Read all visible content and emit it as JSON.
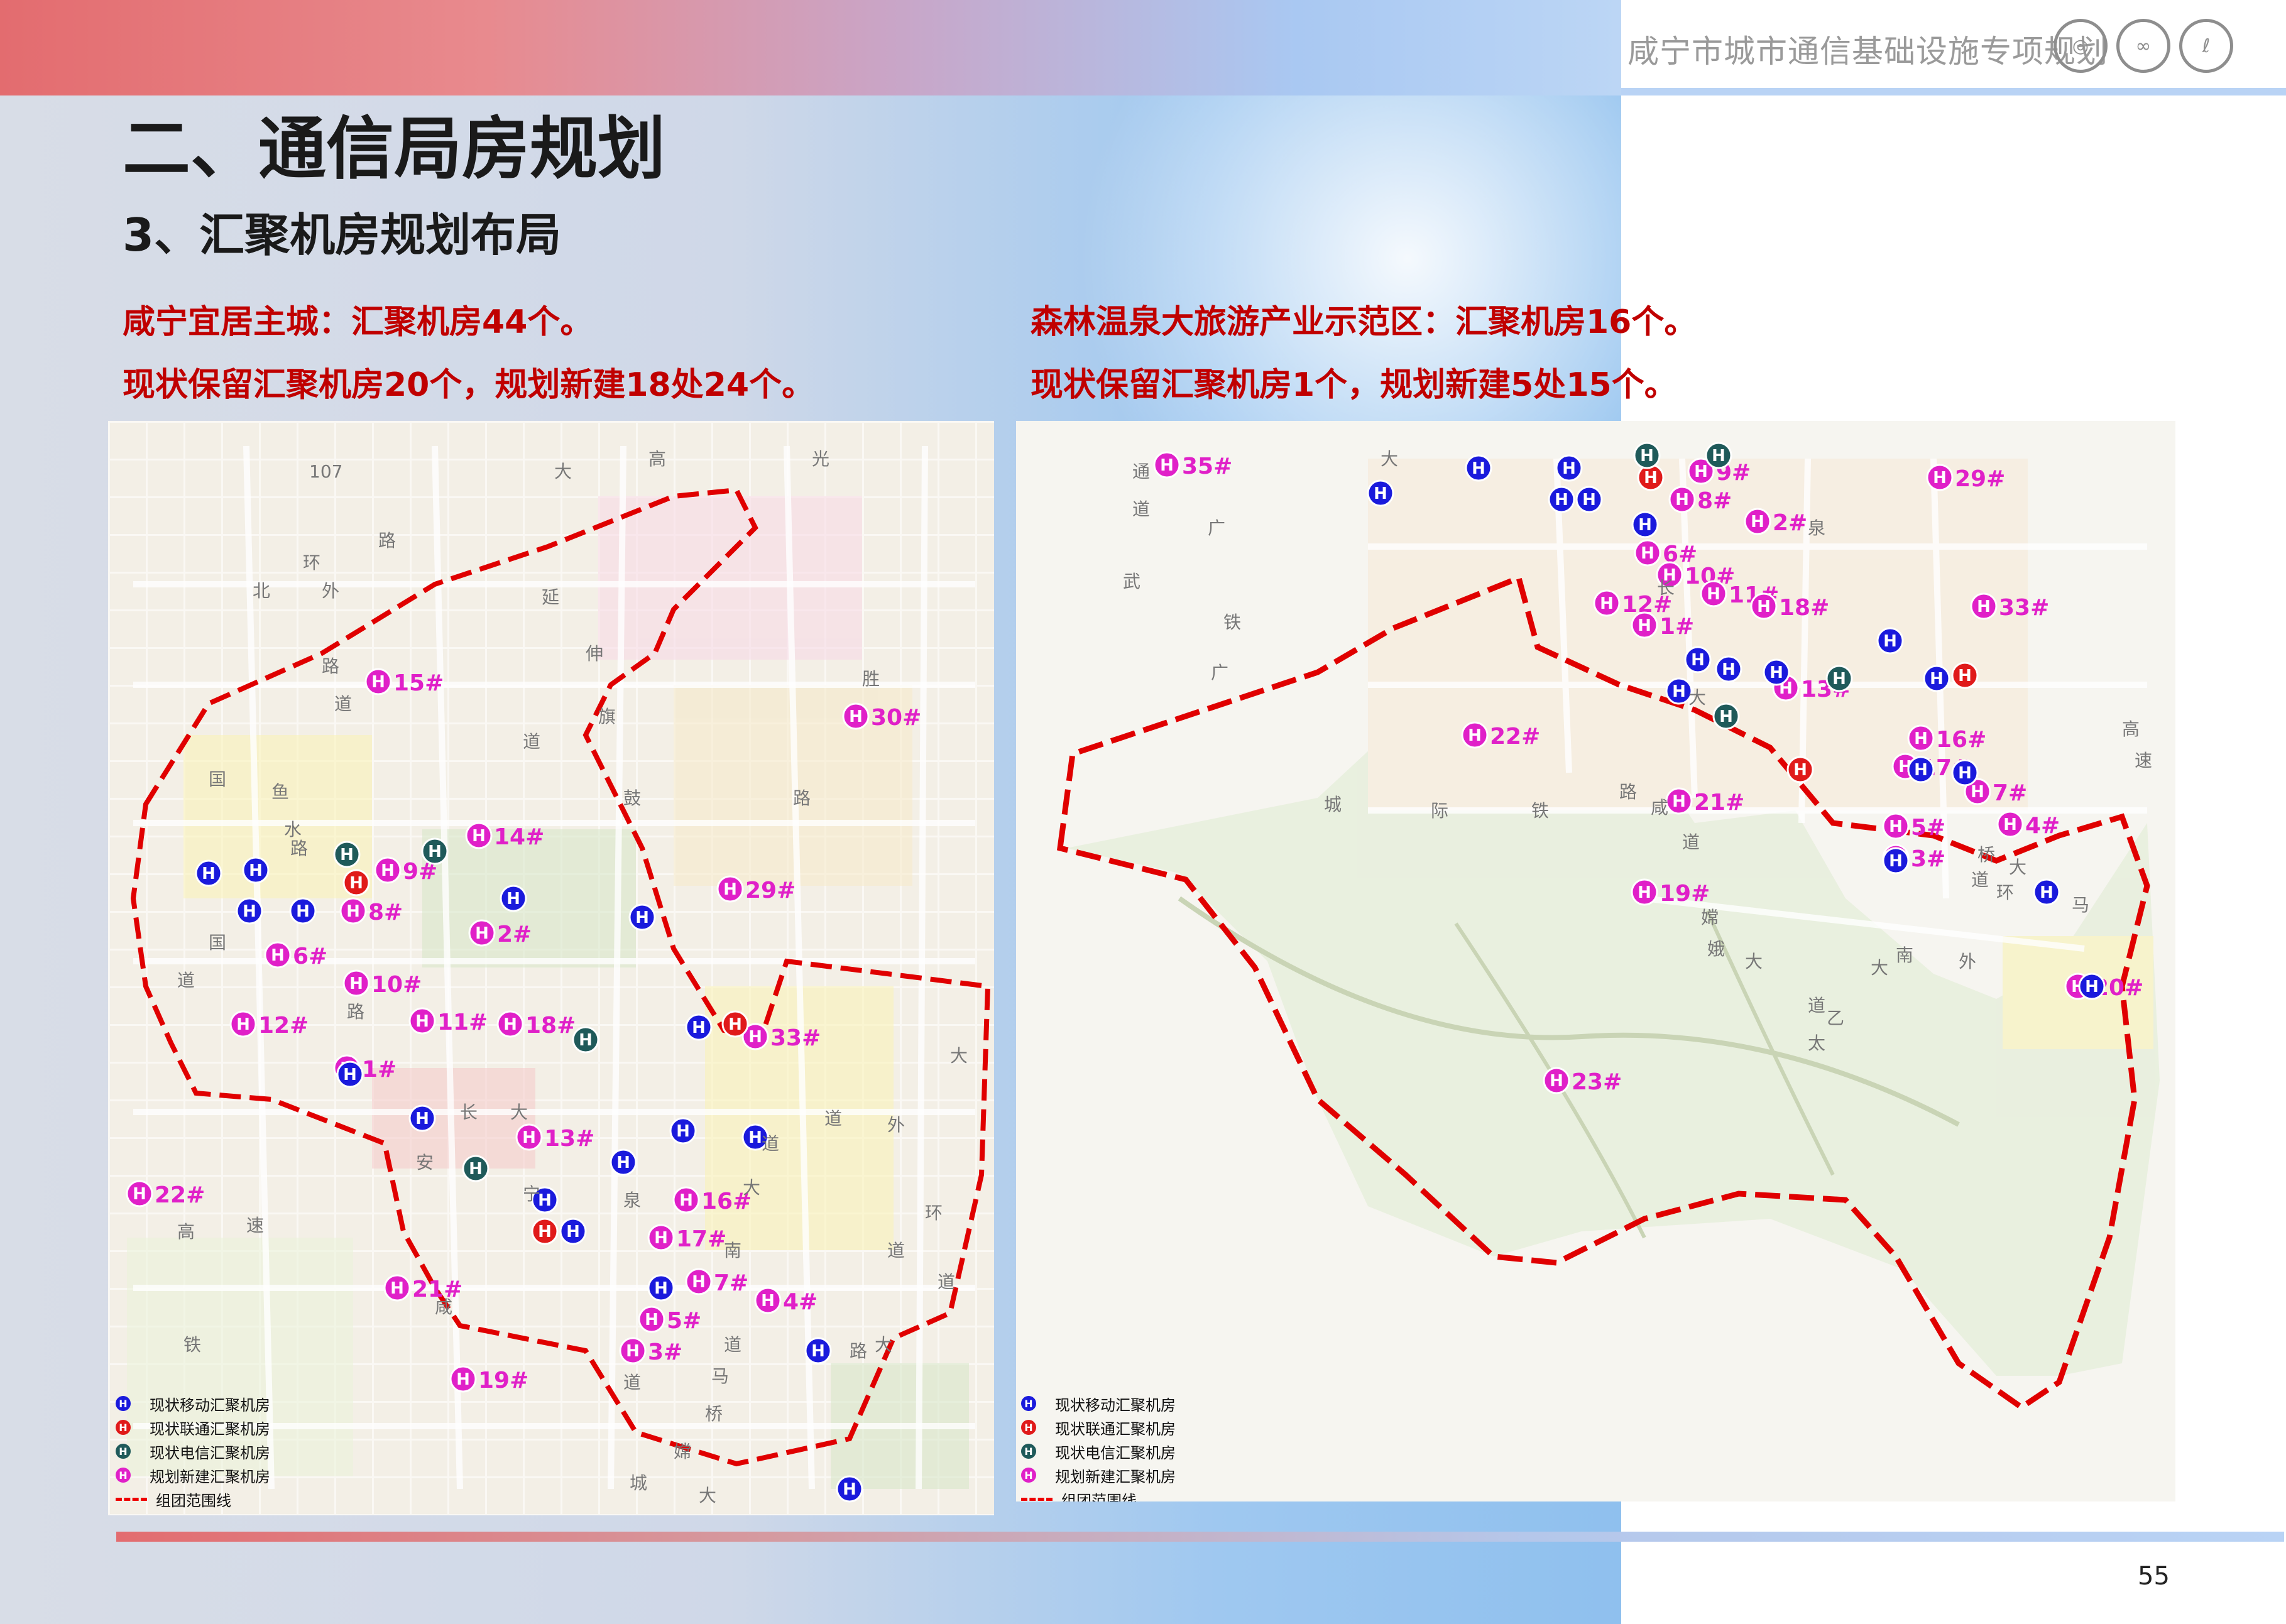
{
  "header": {
    "doc_title": "咸宁市城市通信基础设施专项规划",
    "logos": [
      {
        "name": "china-mobile-logo",
        "glyph": "◎"
      },
      {
        "name": "china-unicom-logo",
        "glyph": "∞"
      },
      {
        "name": "china-telecom-logo",
        "glyph": "ℓ"
      }
    ]
  },
  "title": "二、通信局房规划",
  "subtitle": "3、汇聚机房规划布局",
  "left_summary": {
    "line1": "咸宁宜居主城：汇聚机房44个。",
    "line2": "现状保留汇聚机房20个，规划新建18处24个。"
  },
  "right_summary": {
    "line1": "森林温泉大旅游产业示范区：汇聚机房16个。",
    "line2": "现状保留汇聚机房1个，规划新建5处15个。"
  },
  "colors": {
    "mobile": "#1a1adc",
    "unicom": "#e01a1a",
    "telecom": "#1f5a5a",
    "planned": "#e020c8",
    "boundary": "#e00000"
  },
  "legend": [
    {
      "type": "mobile",
      "glyph": "H",
      "label": "现状移动汇聚机房"
    },
    {
      "type": "unicom",
      "glyph": "H",
      "label": "现状联通汇聚机房"
    },
    {
      "type": "telecom",
      "glyph": "H",
      "label": "现状电信汇聚机房"
    },
    {
      "type": "planned",
      "glyph": "H",
      "label": "规划新建汇聚机房"
    },
    {
      "type": "boundary",
      "label": "组团范围线"
    }
  ],
  "left_map": {
    "planned_sites": [
      {
        "label": "15#"
      },
      {
        "label": "30#"
      },
      {
        "label": "14#"
      },
      {
        "label": "9#"
      },
      {
        "label": "8#"
      },
      {
        "label": "2#"
      },
      {
        "label": "29#"
      },
      {
        "label": "6#"
      },
      {
        "label": "10#"
      },
      {
        "label": "11#"
      },
      {
        "label": "18#"
      },
      {
        "label": "12#"
      },
      {
        "label": "1#"
      },
      {
        "label": "33#"
      },
      {
        "label": "13#"
      },
      {
        "label": "22#"
      },
      {
        "label": "16#"
      },
      {
        "label": "17#"
      },
      {
        "label": "21#"
      },
      {
        "label": "7#"
      },
      {
        "label": "4#"
      },
      {
        "label": "5#"
      },
      {
        "label": "3#"
      },
      {
        "label": "19#"
      }
    ],
    "road_labels": [
      "高",
      "大",
      "路",
      "环",
      "北",
      "外",
      "路",
      "道",
      "国",
      "鱼",
      "水",
      "路",
      "延",
      "伸",
      "道",
      "胜",
      "旗",
      "鼓",
      "路",
      "国",
      "道",
      "路",
      "长",
      "安",
      "大",
      "宁",
      "泉",
      "大",
      "路",
      "道",
      "马",
      "桥",
      "大",
      "道",
      "高",
      "速",
      "铁",
      "咸",
      "嫦",
      "城",
      "大",
      "道",
      "南",
      "外",
      "环",
      "道",
      "大",
      "道",
      "道",
      "107",
      "光"
    ]
  },
  "right_map": {
    "planned_sites": [
      {
        "label": "35#"
      },
      {
        "label": "9#"
      },
      {
        "label": "8#"
      },
      {
        "label": "29#"
      },
      {
        "label": "2#"
      },
      {
        "label": "6#"
      },
      {
        "label": "10#"
      },
      {
        "label": "11#"
      },
      {
        "label": "12#"
      },
      {
        "label": "1#"
      },
      {
        "label": "18#"
      },
      {
        "label": "33#"
      },
      {
        "label": "13#"
      },
      {
        "label": "22#"
      },
      {
        "label": "16#"
      },
      {
        "label": "17#"
      },
      {
        "label": "21#"
      },
      {
        "label": "7#"
      },
      {
        "label": "4#"
      },
      {
        "label": "5#"
      },
      {
        "label": "3#"
      },
      {
        "label": "19#"
      },
      {
        "label": "20#"
      },
      {
        "label": "23#"
      }
    ],
    "road_labels": [
      "通",
      "道",
      "大",
      "广",
      "武",
      "铁",
      "广",
      "城",
      "际",
      "铁",
      "路",
      "咸",
      "大",
      "道",
      "嫦",
      "娥",
      "大",
      "道",
      "太",
      "乙",
      "大",
      "南",
      "外",
      "环",
      "大",
      "道",
      "桥",
      "马",
      "高",
      "速",
      "长",
      "泉"
    ]
  },
  "page_number": "55"
}
